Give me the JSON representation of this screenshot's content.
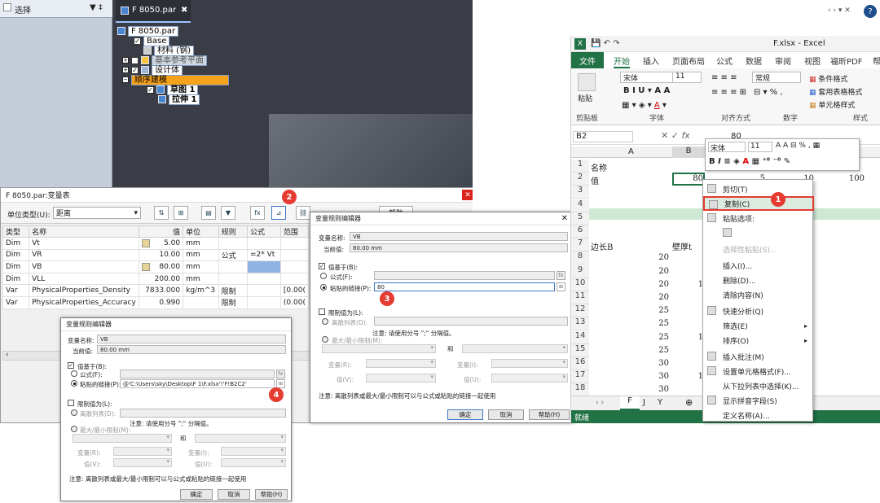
{
  "cad": {
    "pane_title": "选择",
    "pane_icons": "▼ ‡",
    "doc_tab": "F 8050.par",
    "doc_close": "✖",
    "tree": [
      {
        "label": "F 8050.par"
      },
      {
        "label": "Base"
      },
      {
        "label": "材料 (钢)"
      },
      {
        "label": "基本参考平面"
      },
      {
        "label": "设计体"
      },
      {
        "label": "顺序建模"
      },
      {
        "label": "草图 1"
      },
      {
        "label": "拉伸 1"
      }
    ]
  },
  "vartable": {
    "title": "F 8050.par:变量表",
    "unit_type_label": "单位类型(U):",
    "unit_type_value": "距离",
    "help": "帮助",
    "headers": [
      "类型",
      "名称",
      "值",
      "单位",
      "规则",
      "公式",
      "范围"
    ],
    "rows": [
      {
        "type": "Dim",
        "name": "Vt",
        "value": "5.00",
        "unit": "mm",
        "rule": "",
        "formula": "",
        "range": ""
      },
      {
        "type": "Dim",
        "name": "VR",
        "value": "10.00",
        "unit": "mm",
        "rule": "公式",
        "formula": "=2* Vt",
        "range": ""
      },
      {
        "type": "Dim",
        "name": "VB",
        "value": "80.00",
        "unit": "mm",
        "rule": "",
        "formula": "",
        "range": ""
      },
      {
        "type": "Dim",
        "name": "VLL",
        "value": "200.00",
        "unit": "mm",
        "rule": "",
        "formula": "",
        "range": ""
      },
      {
        "type": "Var",
        "name": "PhysicalProperties_Density",
        "value": "7833.000",
        "unit": "kg/m^3",
        "rule": "限制",
        "formula": "",
        "range": "[0.00("
      },
      {
        "type": "Var",
        "name": "PhysicalProperties_Accuracy",
        "value": "0.990",
        "unit": "",
        "rule": "限制",
        "formula": "",
        "range": "(0.00("
      }
    ]
  },
  "dialog_front": {
    "title": "变量规则编辑器",
    "var_name_label": "变量名称:",
    "var_name": "VB",
    "cur_value_label": "当前值:",
    "cur_value": "80.00 mm",
    "based_on": "值基于(B):",
    "formula_opt": "公式(F):",
    "link_opt": "粘贴的链接(P):",
    "link_value": "80",
    "limit": "限制值为(L):",
    "discrete": "离散列表(D):",
    "note_sep": "注意: 请使用分号 \";\" 分隔值。",
    "minmax": "最大/最小限制(M):",
    "and": "和",
    "var_r": "变量(R):",
    "var_i": "变量(I):",
    "val_v": "值(V):",
    "val_u": "值(U):",
    "note_bottom": "注意: 离散列表或最大/最小限制可以与公式或粘贴的链接一起使用",
    "ok": "确定",
    "cancel": "取消",
    "help": "帮助(H)"
  },
  "dialog_back": {
    "title": "变量规则编辑器",
    "var_name_label": "变量名称:",
    "var_name": "VB",
    "cur_value_label": "当前值:",
    "cur_value": "80.00 mm",
    "based_on": "值基于(B):",
    "formula_opt": "公式(F):",
    "link_opt": "粘贴的链接(P):",
    "link_value": "@'C:\\Users\\sky\\Desktop\\F 1\\F.xlsx'!'F!B2C2'",
    "limit": "限制值为(L):",
    "discrete": "离散列表(D):",
    "note_sep": "注意: 请使用分号 \";\" 分隔值。",
    "minmax": "最大/最小限制(M):",
    "and": "和",
    "var_r": "变量(R):",
    "var_i": "变量(I):",
    "val_v": "值(V):",
    "val_u": "值(U):",
    "note_bottom": "注意: 离散列表或最大/最小限制可以与公式或粘贴的链接一起使用",
    "ok": "确定",
    "cancel": "取消",
    "help": "帮助(H)"
  },
  "badges": [
    "1",
    "2",
    "3",
    "4"
  ],
  "excel": {
    "title": "F.xlsx - Excel",
    "window_ctrls": "‹ › ▾ ✕",
    "tabs": [
      "文件",
      "开始",
      "插入",
      "页面布局",
      "公式",
      "数据",
      "审阅",
      "视图",
      "福昕PDF",
      "帮"
    ],
    "font": "宋体",
    "size": "11",
    "numfmt": "常规",
    "groups": [
      "剪贴板",
      "字体",
      "对齐方式",
      "数字",
      "样式"
    ],
    "right_btns": [
      "条件格式",
      "套用表格格式",
      "单元格样式"
    ],
    "paste": "粘贴",
    "name_box": "B2",
    "formula": "80",
    "col_a": "A",
    "col_b": "B",
    "col_l": "L",
    "rows": [
      {
        "n": "1",
        "a": "名称",
        "b": ""
      },
      {
        "n": "2",
        "a": "值",
        "b": "80",
        "c": "5",
        "d": "10",
        "e": "100"
      },
      {
        "n": "3"
      },
      {
        "n": "4"
      },
      {
        "n": "5"
      },
      {
        "n": "6"
      },
      {
        "n": "7",
        "a": "边长B",
        "b": "壁厚t"
      },
      {
        "n": "8",
        "a": "20"
      },
      {
        "n": "9",
        "a": "20"
      },
      {
        "n": "10",
        "a": "20",
        "b": "1"
      },
      {
        "n": "11",
        "a": "20"
      },
      {
        "n": "12",
        "a": "25"
      },
      {
        "n": "13",
        "a": "25"
      },
      {
        "n": "14",
        "a": "25",
        "b": "1"
      },
      {
        "n": "15",
        "a": "25"
      },
      {
        "n": "16",
        "a": "30"
      },
      {
        "n": "17",
        "a": "30",
        "b": "1"
      },
      {
        "n": "18",
        "a": "30"
      },
      {
        "n": "19",
        "a": "30"
      }
    ],
    "sheets": [
      "F",
      "J",
      "Y"
    ],
    "status": "就绪"
  },
  "context_menu": {
    "items": [
      "剪切(T)",
      "复制(C)",
      "粘贴选项:",
      "",
      "选择性粘贴(S)...",
      "插入(I)...",
      "删除(D)...",
      "清除内容(N)",
      "快速分析(Q)",
      "筛选(E)",
      "排序(O)",
      "插入批注(M)",
      "设置单元格格式(F)...",
      "从下拉列表中选择(K)...",
      "显示拼音字段(S)",
      "定义名称(A)..."
    ]
  },
  "mini_toolbar": {
    "font": "宋体",
    "size": "11"
  },
  "colors": {
    "excel_green": "#217346",
    "badge_red": "#e53b30",
    "highlight": "#fbe9a8"
  }
}
